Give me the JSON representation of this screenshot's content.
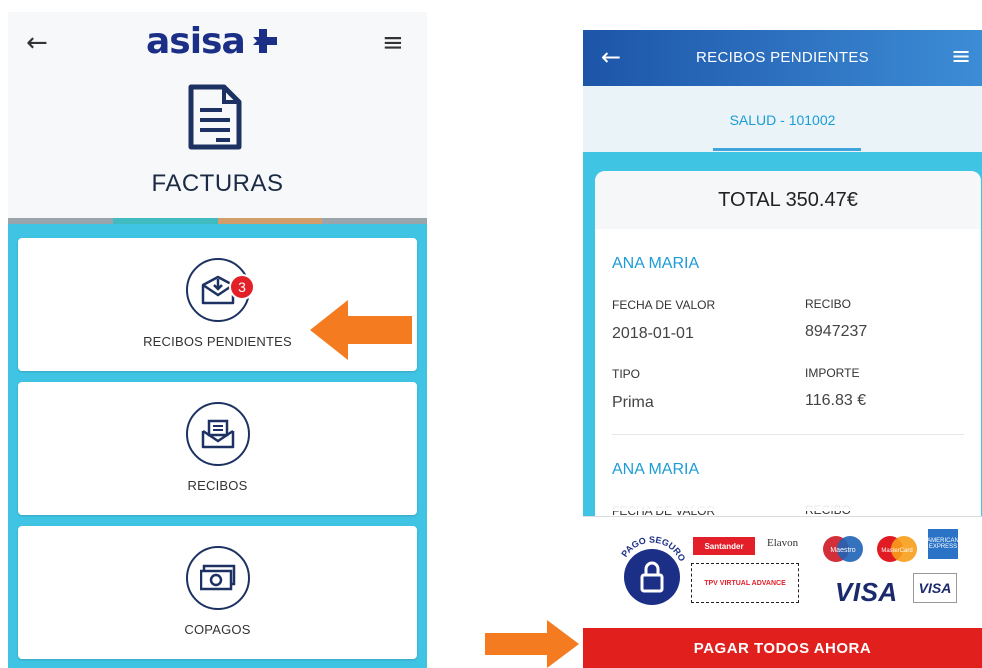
{
  "left": {
    "back_glyph": "←",
    "menu_glyph": "≡",
    "logo_text": "asisa",
    "title": "FACTURAS",
    "tab_colors": [
      "#9aa4ab",
      "#40bcc0",
      "#d39c6b",
      "#9aa4ab"
    ],
    "cards": [
      {
        "label": "RECIBOS PENDIENTES",
        "icon": "envelope-download-icon",
        "badge": "3"
      },
      {
        "label": "RECIBOS",
        "icon": "envelope-letter-icon"
      },
      {
        "label": "COPAGOS",
        "icon": "banknote-icon"
      }
    ]
  },
  "right": {
    "back_glyph": "←",
    "menu_glyph": "≡",
    "header_title": "RECIBOS PENDIENTES",
    "tab_label": "SALUD - 101002",
    "total": "TOTAL 350.47€",
    "receipts": [
      {
        "name": "ANA MARIA",
        "fecha_label": "FECHA DE VALOR",
        "fecha_value": "2018-01-01",
        "recibo_label": "RECIBO",
        "recibo_value": "8947237",
        "tipo_label": "TIPO",
        "tipo_value": "Prima",
        "importe_label": "IMPORTE",
        "importe_value": "116.83 €"
      },
      {
        "name": "ANA MARIA",
        "fecha_label": "FECHA DE VALOR",
        "recibo_label": "RECIBO"
      }
    ],
    "payment": {
      "secure_text": "PAGO SEGURO",
      "santander": "Santander",
      "elavon": "Elavon",
      "tpv": "TPV VIRTUAL ADVANCE",
      "maestro": "Maestro",
      "mastercard": "MasterCard",
      "amex": "AMERICAN EXPRESS",
      "visa": "VISA",
      "visa_small": "VISA"
    },
    "pay_button": "PAGAR TODOS AHORA"
  },
  "colors": {
    "accent_cyan": "#3fc4e3",
    "navy": "#1b2f86",
    "badge_red": "#e32028",
    "arrow_orange": "#f47b20",
    "pay_red": "#e1201e",
    "link_blue": "#1c9cd6"
  }
}
